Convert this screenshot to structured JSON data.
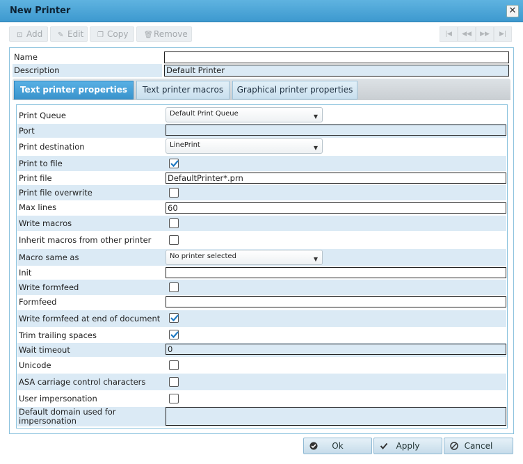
{
  "window": {
    "title": "New Printer",
    "close_icon": "close-icon"
  },
  "toolbar": {
    "add": {
      "label": "Add",
      "icon": "add-icon"
    },
    "edit": {
      "label": "Edit",
      "icon": "edit-icon"
    },
    "copy": {
      "label": "Copy",
      "icon": "copy-icon"
    },
    "remove": {
      "label": "Remove",
      "icon": "trash-icon"
    },
    "nav": [
      "first-icon",
      "prev-icon",
      "next-icon",
      "last-icon"
    ]
  },
  "header_fields": {
    "name": {
      "label": "Name",
      "value": ""
    },
    "description": {
      "label": "Description",
      "value": "Default Printer"
    }
  },
  "tabs": [
    {
      "label": "Text printer properties",
      "active": true
    },
    {
      "label": "Text printer macros",
      "active": false
    },
    {
      "label": "Graphical printer properties",
      "active": false
    }
  ],
  "props": {
    "print_queue": {
      "label": "Print Queue",
      "value": "Default Print Queue"
    },
    "port": {
      "label": "Port",
      "value": ""
    },
    "print_destination": {
      "label": "Print destination",
      "value": "LinePrint"
    },
    "print_to_file": {
      "label": "Print to file",
      "checked": true
    },
    "print_file": {
      "label": "Print file",
      "value": "DefaultPrinter*.prn"
    },
    "print_file_overwrite": {
      "label": "Print file overwrite",
      "checked": false
    },
    "max_lines": {
      "label": "Max lines",
      "value": "60"
    },
    "write_macros": {
      "label": "Write macros",
      "checked": false
    },
    "inherit_macros": {
      "label": "Inherit macros from other printer",
      "checked": false
    },
    "macro_same_as": {
      "label": "Macro same as",
      "value": "No printer selected"
    },
    "init": {
      "label": "Init",
      "value": ""
    },
    "write_formfeed": {
      "label": "Write formfeed",
      "checked": false
    },
    "formfeed": {
      "label": "Formfeed",
      "value": ""
    },
    "formfeed_end": {
      "label": "Write formfeed at end of document",
      "checked": true
    },
    "trim_spaces": {
      "label": "Trim trailing spaces",
      "checked": true
    },
    "wait_timeout": {
      "label": "Wait timeout",
      "value": "0"
    },
    "unicode": {
      "label": "Unicode",
      "checked": false
    },
    "asa": {
      "label": "ASA carriage control characters",
      "checked": false
    },
    "impersonation": {
      "label": "User impersonation",
      "checked": false
    },
    "default_domain": {
      "label": "Default domain used for impersonation",
      "value": ""
    }
  },
  "buttons": {
    "ok": {
      "label": "Ok",
      "icon": "check-circle-icon"
    },
    "apply": {
      "label": "Apply",
      "icon": "check-icon"
    },
    "cancel": {
      "label": "Cancel",
      "icon": "cancel-circle-icon"
    }
  }
}
